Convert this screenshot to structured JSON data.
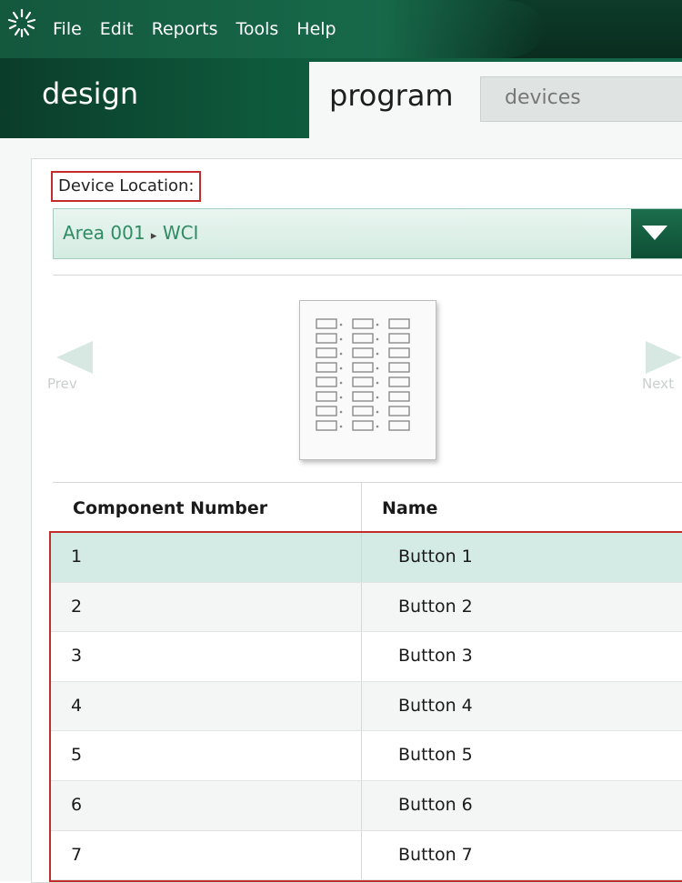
{
  "menu": {
    "items": [
      "File",
      "Edit",
      "Reports",
      "Tools",
      "Help"
    ]
  },
  "tabs": {
    "design": "design",
    "program": "program",
    "devices": "devices"
  },
  "location": {
    "label": "Device Location:",
    "area": "Area 001",
    "separator": "▸",
    "device": "WCI"
  },
  "nav": {
    "prev": "Prev",
    "next": "Next"
  },
  "table": {
    "headers": [
      "Component Number",
      "Name"
    ],
    "rows": [
      {
        "number": "1",
        "name": "Button 1",
        "selected": true
      },
      {
        "number": "2",
        "name": "Button 2"
      },
      {
        "number": "3",
        "name": "Button 3"
      },
      {
        "number": "4",
        "name": "Button 4"
      },
      {
        "number": "5",
        "name": "Button 5"
      },
      {
        "number": "6",
        "name": "Button 6"
      },
      {
        "number": "7",
        "name": "Button 7"
      }
    ]
  },
  "colors": {
    "brand_dark": "#0b3d2a",
    "brand_green": "#17694a",
    "accent_text": "#2f8c63",
    "selection": "#d3ebe4",
    "highlight_box": "#c42b2b"
  },
  "icons": {
    "logo": "starburst-logo-icon",
    "dropdown": "triangle-down-icon",
    "prev": "arrow-left-icon",
    "next": "arrow-right-icon",
    "device": "keypad-device-icon"
  }
}
